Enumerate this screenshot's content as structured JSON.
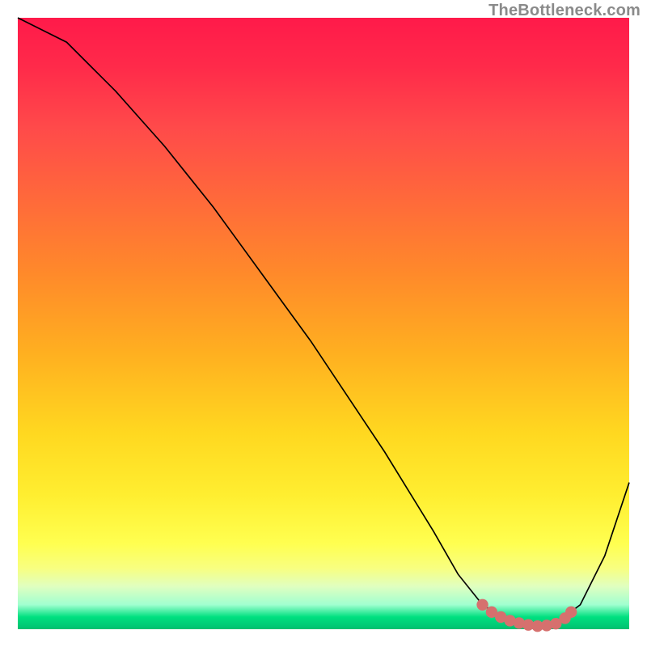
{
  "watermark": "TheBottleneck.com",
  "chart_data": {
    "type": "line",
    "title": "",
    "xlabel": "",
    "ylabel": "",
    "xlim": [
      0,
      100
    ],
    "ylim": [
      0,
      100
    ],
    "series": [
      {
        "name": "bottleneck-curve",
        "x": [
          0,
          4,
          8,
          12,
          16,
          20,
          24,
          28,
          32,
          36,
          40,
          44,
          48,
          52,
          56,
          60,
          64,
          68,
          72,
          76,
          80,
          84,
          88,
          92,
          96,
          100
        ],
        "values": [
          100,
          98,
          96,
          92,
          88,
          83.5,
          79,
          74,
          69,
          63.5,
          58,
          52.5,
          47,
          41,
          35,
          29,
          22.5,
          16,
          9,
          4,
          1.5,
          0.5,
          1,
          4,
          12,
          24
        ]
      }
    ],
    "highlight": {
      "name": "optimal-range-markers",
      "color": "#d6706e",
      "x": [
        76,
        77.5,
        79,
        80.5,
        82,
        83.5,
        85,
        86.5,
        88,
        89.5,
        90.5
      ],
      "values": [
        4,
        2.8,
        2,
        1.4,
        1,
        0.7,
        0.5,
        0.6,
        0.9,
        1.8,
        2.8
      ]
    },
    "background_gradient": {
      "top": "#ff1a4a",
      "mid": "#ffd820",
      "bottom": "#00c070"
    }
  }
}
